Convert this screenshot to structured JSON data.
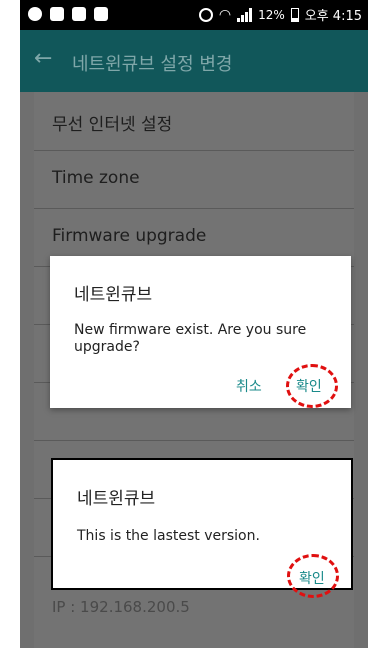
{
  "status_bar": {
    "battery": "12%",
    "time": "오후 4:15"
  },
  "app_bar": {
    "title": "네트윈큐브 설정 변경",
    "back_icon": "arrow-left-icon"
  },
  "settings": {
    "items": [
      {
        "label": "무선 인터넷 설정"
      },
      {
        "label": "Time zone"
      },
      {
        "label": "Firmware upgrade"
      }
    ],
    "ip": "IP : 192.168.200.5"
  },
  "dialog_update": {
    "title": "네트윈큐브",
    "message": "New firmware exist. Are you sure upgrade?",
    "cancel_label": "취소",
    "ok_label": "확인"
  },
  "dialog_latest": {
    "title": "네트윈큐브",
    "message": "This is the lastest version.",
    "ok_label": "확인"
  },
  "colors": {
    "app_bar": "#11575a",
    "accent": "#1a8a8a",
    "highlight": "#e01010"
  }
}
